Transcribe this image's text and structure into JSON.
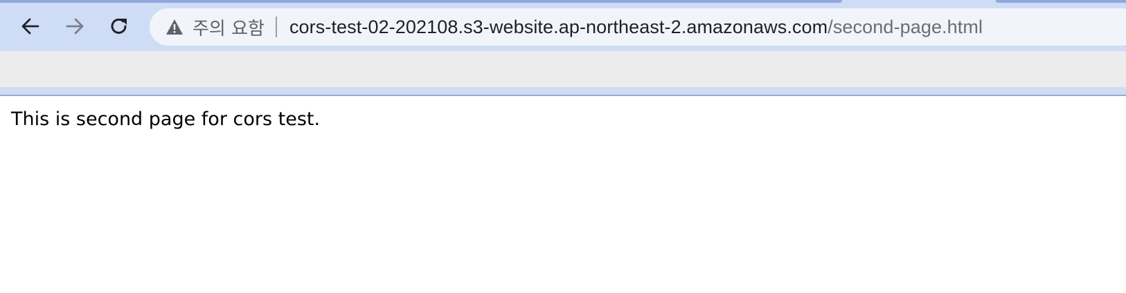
{
  "toolbar": {
    "back_icon": "arrow-left-icon",
    "forward_icon": "arrow-right-icon",
    "reload_icon": "reload-icon",
    "security_icon": "warning-triangle-icon",
    "security_label": "주의 요함",
    "url_host": "cors-test-02-202108.s3-website.ap-northeast-2.amazonaws.com",
    "url_path": "/second-page.html"
  },
  "page": {
    "text": "This is second page for cors test."
  },
  "colors": {
    "toolbar_bg": "#cfdcf5",
    "omnibox_bg": "#f1f4fb",
    "bookmarks_bg": "#ececec"
  }
}
